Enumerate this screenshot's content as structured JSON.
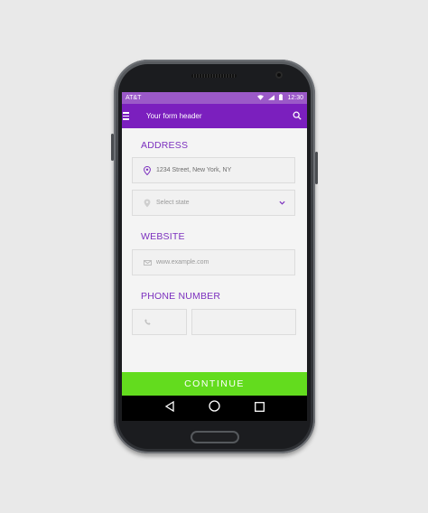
{
  "status_bar": {
    "carrier": "AT&T",
    "time": "12:30"
  },
  "app_bar": {
    "title": "Your form header"
  },
  "address": {
    "label": "ADDRESS",
    "street_value": "1234 Street, New York, NY",
    "state_placeholder": "Select state"
  },
  "website": {
    "label": "WEBSITE",
    "placeholder": "www.example.com"
  },
  "phone": {
    "label": "PHONE NUMBER"
  },
  "continue_label": "CONTINUE",
  "colors": {
    "status_bar": "#9b59c8",
    "app_bar": "#7b1fbe",
    "accent": "#7b2fbe",
    "continue": "#63dc1e",
    "background": "#e9e9e9"
  },
  "icons": [
    "menu-icon",
    "search-icon",
    "wifi-icon",
    "signal-icon",
    "battery-icon",
    "location-pin-icon",
    "chevron-down-icon",
    "mail-icon",
    "phone-icon",
    "back-icon",
    "home-icon",
    "recents-icon"
  ]
}
